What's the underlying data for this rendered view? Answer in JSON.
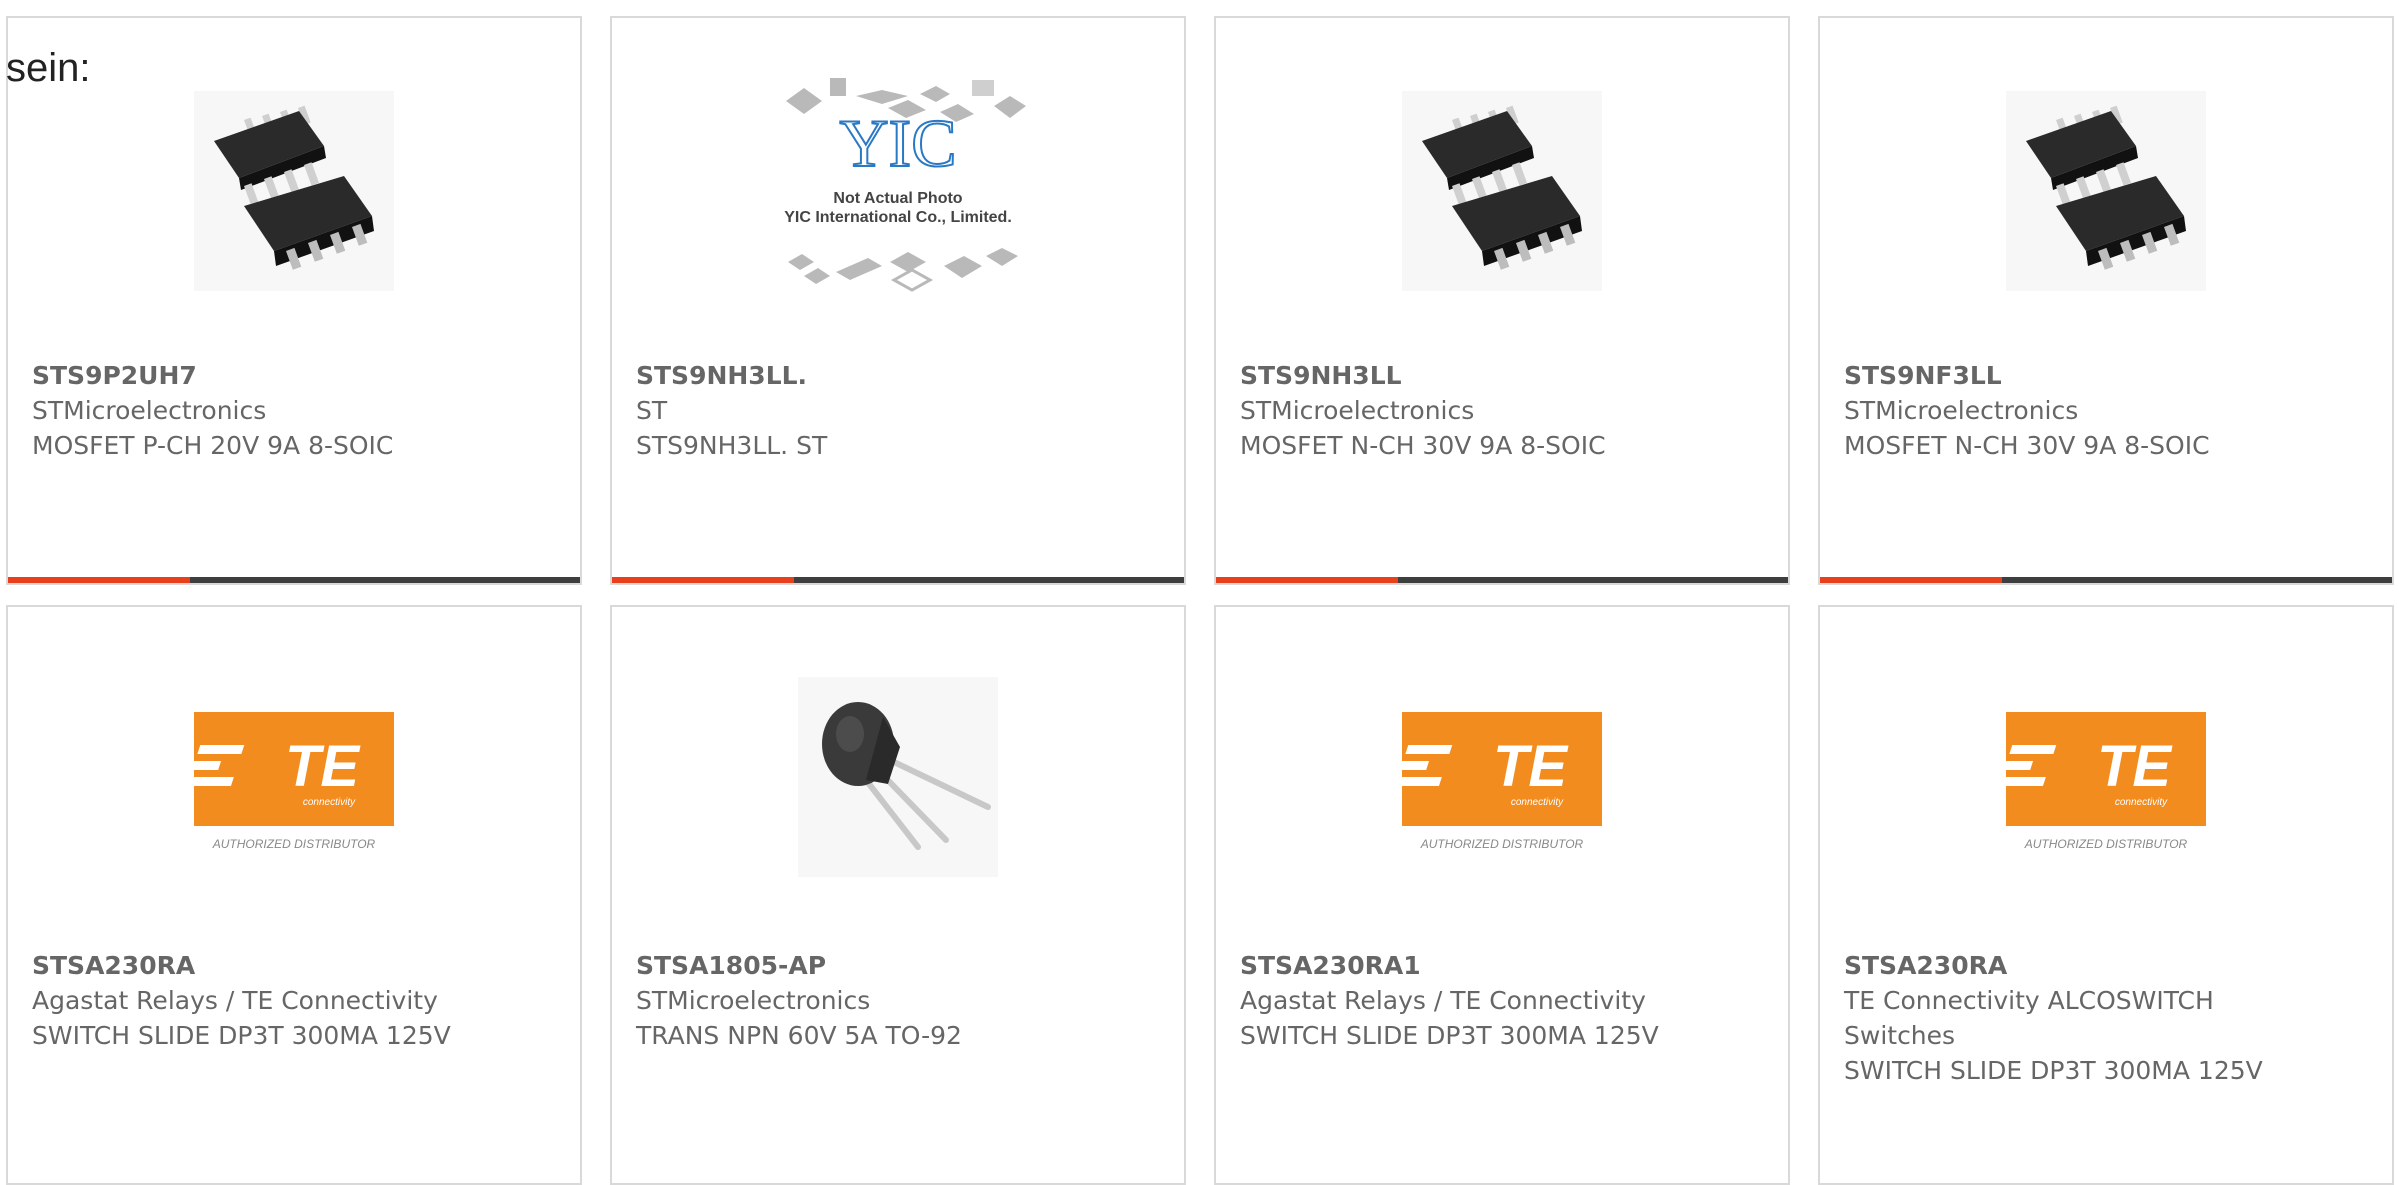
{
  "intro_text": "sein:",
  "colors": {
    "accent": "#e8401c",
    "bar": "#3e3e3e",
    "te_orange": "#f28c1e",
    "text": "#666666"
  },
  "products": [
    {
      "part": "STS9P2UH7",
      "manufacturer": "STMicroelectronics",
      "description": "MOSFET P-CH 20V 9A 8-SOIC",
      "image": "soic8-chip"
    },
    {
      "part": "STS9NH3LL.",
      "manufacturer": "ST",
      "description": "STS9NH3LL. ST",
      "image": "yic-placeholder",
      "image_text": {
        "logo": "YIC",
        "line1": "Not Actual Photo",
        "line2": "YIC International Co., Limited."
      }
    },
    {
      "part": "STS9NH3LL",
      "manufacturer": "STMicroelectronics",
      "description": "MOSFET N-CH 30V 9A 8-SOIC",
      "image": "soic8-chip"
    },
    {
      "part": "STS9NF3LL",
      "manufacturer": "STMicroelectronics",
      "description": "MOSFET N-CH 30V 9A 8-SOIC",
      "image": "soic8-chip"
    },
    {
      "part": "STSA230RA",
      "manufacturer": "Agastat Relays / TE Connectivity",
      "description": "SWITCH SLIDE DP3T 300MA 125V",
      "image": "te-logo",
      "image_text": {
        "logo": "TE",
        "sub": "connectivity",
        "caption": "AUTHORIZED DISTRIBUTOR"
      }
    },
    {
      "part": "STSA1805-AP",
      "manufacturer": "STMicroelectronics",
      "description": "TRANS NPN 60V 5A TO-92",
      "image": "to92-transistor"
    },
    {
      "part": "STSA230RA1",
      "manufacturer": "Agastat Relays / TE Connectivity",
      "description": "SWITCH SLIDE DP3T 300MA 125V",
      "image": "te-logo",
      "image_text": {
        "logo": "TE",
        "sub": "connectivity",
        "caption": "AUTHORIZED DISTRIBUTOR"
      }
    },
    {
      "part": "STSA230RA",
      "manufacturer": "TE Connectivity ALCOSWITCH Switches",
      "description": "SWITCH SLIDE DP3T 300MA 125V",
      "image": "te-logo",
      "image_text": {
        "logo": "TE",
        "sub": "connectivity",
        "caption": "AUTHORIZED DISTRIBUTOR"
      }
    }
  ]
}
